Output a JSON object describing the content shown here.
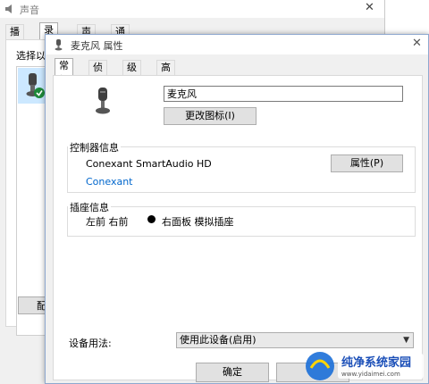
{
  "back_window": {
    "title": "声音",
    "close_glyph": "✕",
    "tabs": [
      "播放",
      "录制",
      "声音",
      "通信"
    ],
    "active_tab": 1,
    "select_label": "选择以",
    "configure_label": "配"
  },
  "dialog": {
    "title": "麦克风 属性",
    "close_glyph": "✕",
    "tabs": [
      "常规",
      "侦听",
      "级别",
      "高级"
    ],
    "active_tab": 0,
    "device_name": "麦克风",
    "change_icon_label": "更改图标(I)",
    "controller_group": {
      "title": "控制器信息",
      "name": "Conexant SmartAudio HD",
      "properties_label": "属性(P)",
      "vendor_link": "Conexant"
    },
    "jack_group": {
      "title": "插座信息",
      "position": "左前 右前",
      "jack_desc": "右面板 模拟插座"
    },
    "usage_label": "设备用法:",
    "usage_value": "使用此设备(启用)",
    "ok_label": "确定"
  },
  "watermark": {
    "text": "纯净系统家园",
    "url": "www.yidaimei.com"
  },
  "colors": {
    "accent": "#0066cc",
    "selection": "#cce8ff",
    "check": "#1e8a3a"
  }
}
